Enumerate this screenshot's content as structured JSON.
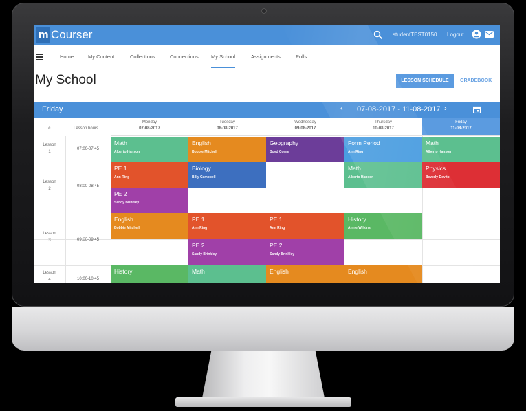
{
  "app": {
    "logo_m": "m",
    "logo_rest": "Courser",
    "user": "studentTEST0150",
    "logout": "Logout"
  },
  "nav": {
    "tabs": [
      "Home",
      "My Content",
      "Collections",
      "Connections",
      "My School",
      "Assignments",
      "Polls"
    ],
    "active": "My School"
  },
  "page": {
    "title": "My School",
    "lesson_schedule_button": "LESSON SCHEDULE",
    "gradebook_button": "GRADEBOOK"
  },
  "schedule": {
    "day": "Friday",
    "range": "07-08-2017 - 11-08-2017",
    "header_num": "#",
    "header_hours": "Lesson hours",
    "days": [
      {
        "name": "Monday",
        "date": "07-08-2017"
      },
      {
        "name": "Tuesday",
        "date": "08-08-2017"
      },
      {
        "name": "Wednesday",
        "date": "09-08-2017"
      },
      {
        "name": "Thursday",
        "date": "10-08-2017"
      },
      {
        "name": "Friday",
        "date": "11-08-2017"
      }
    ],
    "lessons": [
      {
        "label": "Lesson",
        "num": "1",
        "time": "07:00-07:45"
      },
      {
        "label": "Lesson",
        "num": "2",
        "time": "08:00-08:45"
      },
      {
        "label": "Lesson",
        "num": "3",
        "time": "09:00-09:45"
      },
      {
        "label": "Lesson",
        "num": "4",
        "time": "10:00-10:45"
      }
    ],
    "cells": [
      {
        "subject": "Math",
        "teacher": "Alberto Hanson",
        "color": "#5cbf8f"
      },
      {
        "subject": "English",
        "teacher": "Bobbie Mitchell",
        "color": "#e58a1f"
      },
      {
        "subject": "Geography",
        "teacher": "Boyd Corne",
        "color": "#6c3d99"
      },
      {
        "subject": "Form Period",
        "teacher": "Ann Ring",
        "color": "#4a9de0"
      },
      {
        "subject": "Math",
        "teacher": "Alberto Hanson",
        "color": "#5cbf8f"
      },
      {
        "subject": "PE 1",
        "teacher": "Ann Ring",
        "color": "#e2532b"
      },
      {
        "subject": "Biology",
        "teacher": "Billy Campbell",
        "color": "#3d6fbf"
      },
      {
        "subject": "Math",
        "teacher": "Alberto Hanson",
        "color": "#5cbf8f"
      },
      {
        "subject": "Physics",
        "teacher": "Beverly Devito",
        "color": "#dd2f35"
      },
      {
        "subject": "PE 2",
        "teacher": "Sandy Brinkley",
        "color": "#a040a8"
      },
      {
        "subject": "English",
        "teacher": "Bobbie Mitchell",
        "color": "#e58a1f"
      },
      {
        "subject": "PE 1",
        "teacher": "Ann Ring",
        "color": "#e2532b"
      },
      {
        "subject": "PE 1",
        "teacher": "Ann Ring",
        "color": "#e2532b"
      },
      {
        "subject": "History",
        "teacher": "Annie Wilkins",
        "color": "#5ab864"
      },
      {
        "subject": "PE 2",
        "teacher": "Sandy Brinkley",
        "color": "#a040a8"
      },
      {
        "subject": "PE 2",
        "teacher": "Sandy Brinkley",
        "color": "#a040a8"
      },
      {
        "subject": "History",
        "teacher": "",
        "color": "#5ab864"
      },
      {
        "subject": "Math",
        "teacher": "",
        "color": "#5cbf8f"
      },
      {
        "subject": "English",
        "teacher": "",
        "color": "#e58a1f"
      },
      {
        "subject": "English",
        "teacher": "",
        "color": "#e58a1f"
      }
    ]
  },
  "colors": {
    "brand": "#4a90d9",
    "today_header": "#5b9be0"
  },
  "icons": [
    "search-icon",
    "account-icon",
    "mail-icon",
    "menu-icon",
    "calendar-icon",
    "chevron-left-icon",
    "chevron-right-icon"
  ]
}
